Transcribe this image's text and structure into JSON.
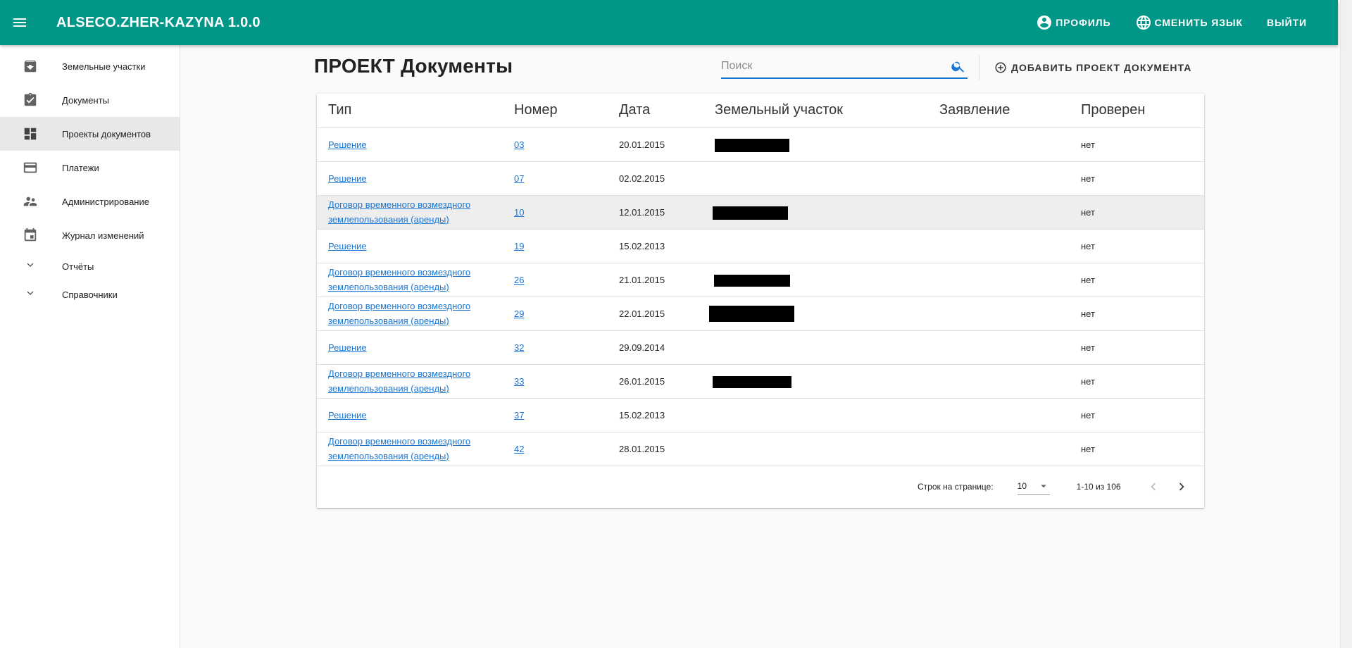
{
  "app": {
    "title": "ALSECO.ZHER-KAZYNA 1.0.0",
    "accent": "#009688"
  },
  "header": {
    "profile_label": "ПРОФИЛЬ",
    "language_label": "СМЕНИТЬ ЯЗЫК",
    "logout_label": "ВЫЙТИ"
  },
  "sidebar": {
    "items": [
      {
        "label": "Земельные участки",
        "icon": "archive-icon"
      },
      {
        "label": "Документы",
        "icon": "assignment-check-icon"
      },
      {
        "label": "Проекты документов",
        "icon": "dashboard-icon",
        "active": true
      },
      {
        "label": "Платежи",
        "icon": "credit-card-icon"
      },
      {
        "label": "Администрирование",
        "icon": "people-icon"
      },
      {
        "label": "Журнал изменений",
        "icon": "calendar-icon"
      }
    ],
    "groups": [
      {
        "label": "Отчёты",
        "icon": "chevron-down-icon"
      },
      {
        "label": "Справочники",
        "icon": "chevron-down-icon"
      }
    ]
  },
  "main": {
    "title": "ПРОЕКТ Документы",
    "search_placeholder": "Поиск",
    "add_label": "ДОБАВИТЬ ПРОЕКТ ДОКУМЕНТА"
  },
  "table": {
    "columns": [
      "Тип",
      "Номер",
      "Дата",
      "Земельный участок",
      "Заявление",
      "Проверен"
    ],
    "rows": [
      {
        "type": "Решение",
        "number": "03",
        "date": "20.01.2015",
        "redacted": true,
        "application": "",
        "checked": "нет"
      },
      {
        "type": "Решение",
        "number": "07",
        "date": "02.02.2015",
        "redacted": false,
        "application": "",
        "checked": "нет"
      },
      {
        "type": "Договор временного возмездного землепользования (аренды)",
        "number": "10",
        "date": "12.01.2015",
        "redacted": true,
        "application": "",
        "checked": "нет",
        "highlight": true
      },
      {
        "type": "Решение",
        "number": "19",
        "date": "15.02.2013",
        "redacted": false,
        "application": "",
        "checked": "нет"
      },
      {
        "type": "Договор временного возмездного землепользования (аренды)",
        "number": "26",
        "date": "21.01.2015",
        "redacted": true,
        "application": "",
        "checked": "нет"
      },
      {
        "type": "Договор временного возмездного землепользования (аренды)",
        "number": "29",
        "date": "22.01.2015",
        "redacted": true,
        "application": "",
        "checked": "нет"
      },
      {
        "type": "Решение",
        "number": "32",
        "date": "29.09.2014",
        "redacted": false,
        "application": "",
        "checked": "нет"
      },
      {
        "type": "Договор временного возмездного землепользования (аренды)",
        "number": "33",
        "date": "26.01.2015",
        "redacted": true,
        "application": "",
        "checked": "нет"
      },
      {
        "type": "Решение",
        "number": "37",
        "date": "15.02.2013",
        "redacted": false,
        "application": "",
        "checked": "нет"
      },
      {
        "type": "Договор временного возмездного землепользования (аренды)",
        "number": "42",
        "date": "28.01.2015",
        "redacted": false,
        "application": "",
        "checked": "нет"
      }
    ]
  },
  "pagination": {
    "rows_per_page_label": "Строк на странице:",
    "rows_per_page_value": "10",
    "range_label": "1-10 из 106"
  }
}
